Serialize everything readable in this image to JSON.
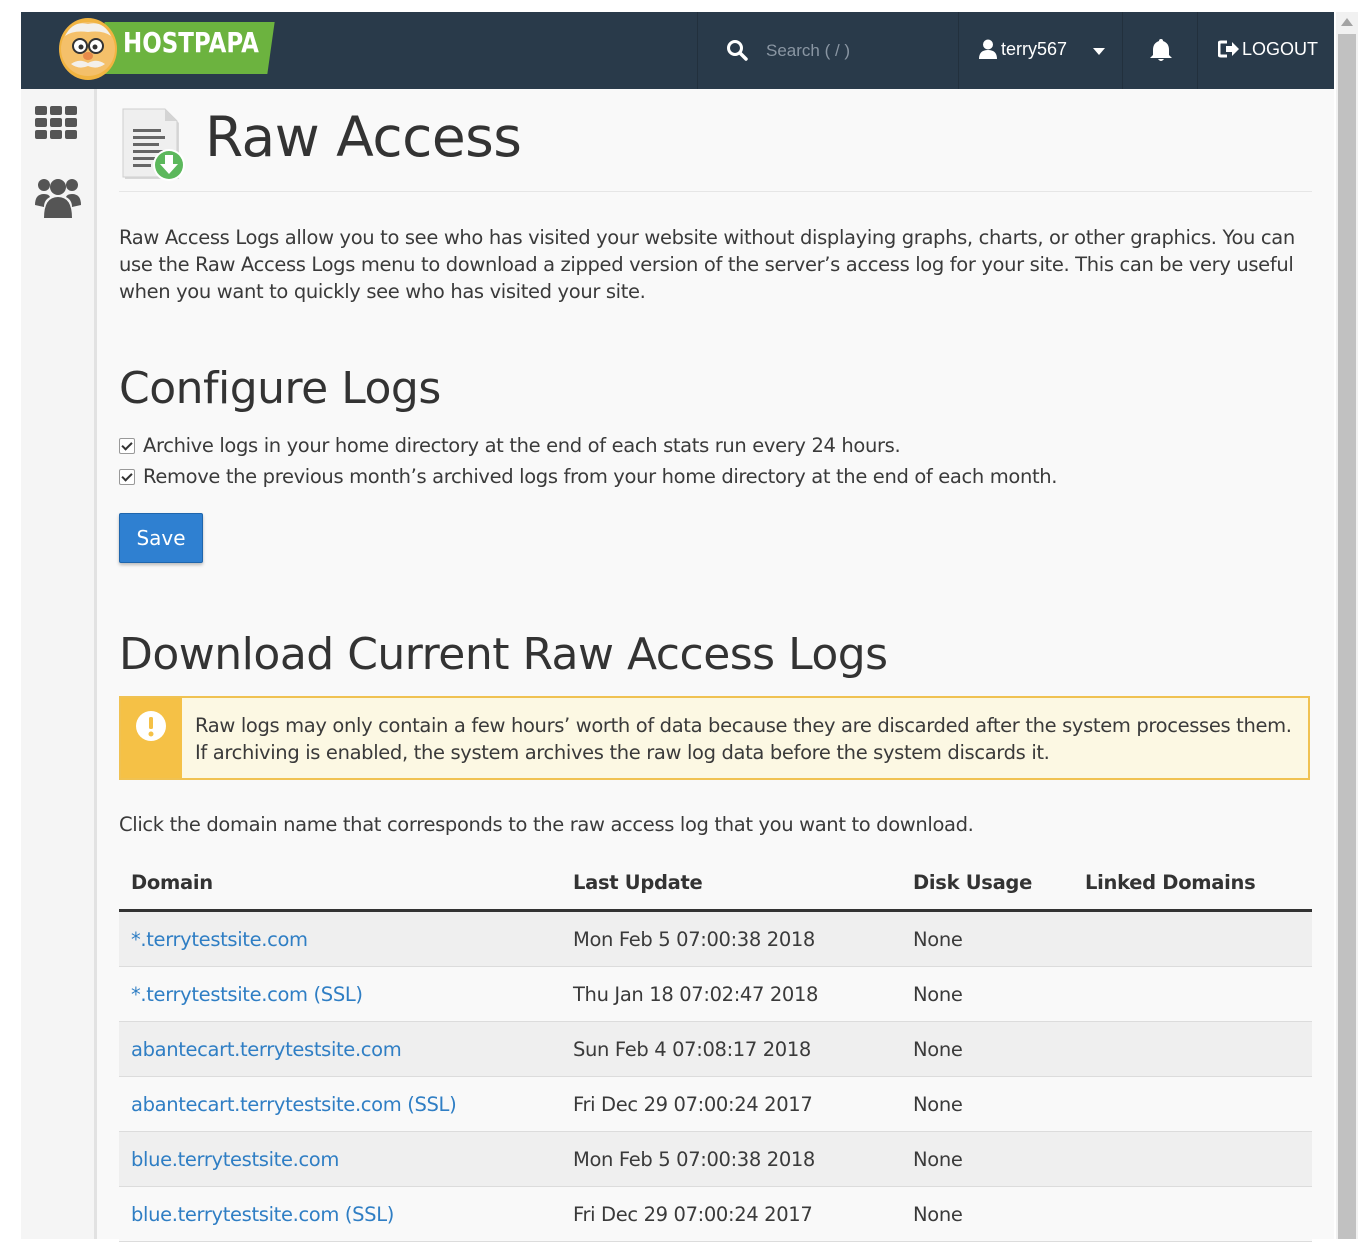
{
  "header": {
    "brand": "HOSTPAPA",
    "search_placeholder": "Search ( / )",
    "username": "terry567",
    "logout_label": "LOGOUT"
  },
  "page": {
    "title": "Raw Access",
    "intro": "Raw Access Logs allow you to see who has visited your website without displaying graphs, charts, or other graphics. You can use the Raw Access Logs menu to download a zipped version of the server’s access log for your site. This can be very useful when you want to quickly see who has visited your site."
  },
  "configure": {
    "heading": "Configure Logs",
    "option_archive": "Archive logs in your home directory at the end of each stats run every 24 hours.",
    "option_remove": "Remove the previous month’s archived logs from your home directory at the end of each month.",
    "save_label": "Save"
  },
  "download": {
    "heading": "Download Current Raw Access Logs",
    "alert": "Raw logs may only contain a few hours’ worth of data because they are discarded after the system processes them. If archiving is enabled, the system archives the raw log data before the system discards it.",
    "note": "Click the domain name that corresponds to the raw access log that you want to download.",
    "columns": {
      "domain": "Domain",
      "last_update": "Last Update",
      "disk_usage": "Disk Usage",
      "linked_domains": "Linked Domains"
    },
    "rows": [
      {
        "domain": "*.terrytestsite.com",
        "last_update": "Mon Feb 5 07:00:38 2018",
        "disk_usage": "None",
        "linked": ""
      },
      {
        "domain": "*.terrytestsite.com (SSL)",
        "last_update": "Thu Jan 18 07:02:47 2018",
        "disk_usage": "None",
        "linked": ""
      },
      {
        "domain": "abantecart.terrytestsite.com",
        "last_update": "Sun Feb 4 07:08:17 2018",
        "disk_usage": "None",
        "linked": ""
      },
      {
        "domain": "abantecart.terrytestsite.com (SSL)",
        "last_update": "Fri Dec 29 07:00:24 2017",
        "disk_usage": "None",
        "linked": ""
      },
      {
        "domain": "blue.terrytestsite.com",
        "last_update": "Mon Feb 5 07:00:38 2018",
        "disk_usage": "None",
        "linked": ""
      },
      {
        "domain": "blue.terrytestsite.com (SSL)",
        "last_update": "Fri Dec 29 07:00:24 2017",
        "disk_usage": "None",
        "linked": ""
      }
    ]
  },
  "colors": {
    "header_bg": "#293a4a",
    "brand_green": "#6cb33f",
    "primary_button": "#2f80d1",
    "link": "#2f7ec4",
    "warning": "#f5c146"
  },
  "icons": {
    "search": "search-icon",
    "user": "user-icon",
    "notifications": "bell-icon",
    "logout": "logout-icon",
    "apps": "grid-icon",
    "users": "users-icon",
    "page": "document-download-icon",
    "alert": "exclamation-icon"
  }
}
